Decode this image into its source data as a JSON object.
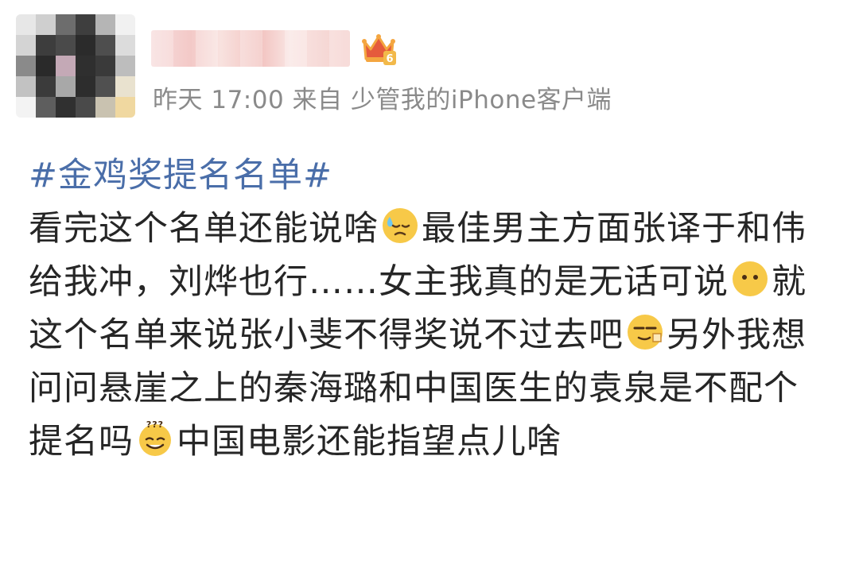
{
  "post": {
    "meta": "昨天 17:00 来自 少管我的iPhone客户端",
    "hashtag": "#金鸡奖提名名单#",
    "body": {
      "s1": "看完这个名单还能说啥",
      "s2": "最佳男主方面张译于和伟给我冲，刘烨也行……女主我真的是无话可说",
      "s3": "就这个名单来说张小斐不得奖说不过去吧",
      "s4": "另外我想问问悬崖之上的秦海璐和中国医生的袁泉是不配个提名吗",
      "s5": "中国电影还能指望点儿啥"
    }
  },
  "icons": {
    "avatar": "avatar-blurred",
    "badge": "crown-badge-icon",
    "badge_level": "6",
    "emojis": [
      "sweat-emoji-icon",
      "speechless-emoji-icon",
      "wink-point-emoji-icon",
      "confused-emoji-icon"
    ]
  }
}
